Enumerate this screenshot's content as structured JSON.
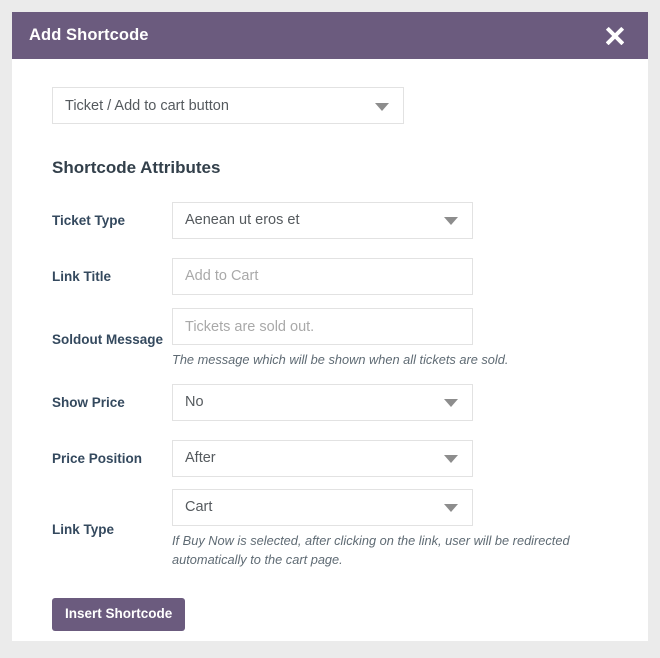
{
  "modal": {
    "title": "Add Shortcode",
    "close_icon": "close-icon"
  },
  "shortcode_type": {
    "selected": "Ticket / Add to cart button",
    "caret_icon": "chevron-down-icon"
  },
  "attributes_section": {
    "heading": "Shortcode Attributes"
  },
  "fields": {
    "ticket_type": {
      "label": "Ticket Type",
      "value": "Aenean ut eros et",
      "caret_icon": "chevron-down-icon"
    },
    "link_title": {
      "label": "Link Title",
      "placeholder": "Add to Cart",
      "value": ""
    },
    "soldout_message": {
      "label": "Soldout Message",
      "placeholder": "Tickets are sold out.",
      "value": "",
      "help": "The message which will be shown when all tickets are sold."
    },
    "show_price": {
      "label": "Show Price",
      "value": "No",
      "caret_icon": "chevron-down-icon"
    },
    "price_position": {
      "label": "Price Position",
      "value": "After",
      "caret_icon": "chevron-down-icon"
    },
    "link_type": {
      "label": "Link Type",
      "value": "Cart",
      "caret_icon": "chevron-down-icon",
      "help": "If Buy Now is selected, after clicking on the link, user will be redirected automatically to the cart page."
    }
  },
  "footer": {
    "insert_label": "Insert Shortcode"
  },
  "colors": {
    "header_purple": "#6b5b7e",
    "page_background": "#ebebeb",
    "modal_background": "#ffffff",
    "label_text": "#34495e",
    "placeholder_text": "#a9a9a9",
    "border": "#e2e2e2"
  }
}
